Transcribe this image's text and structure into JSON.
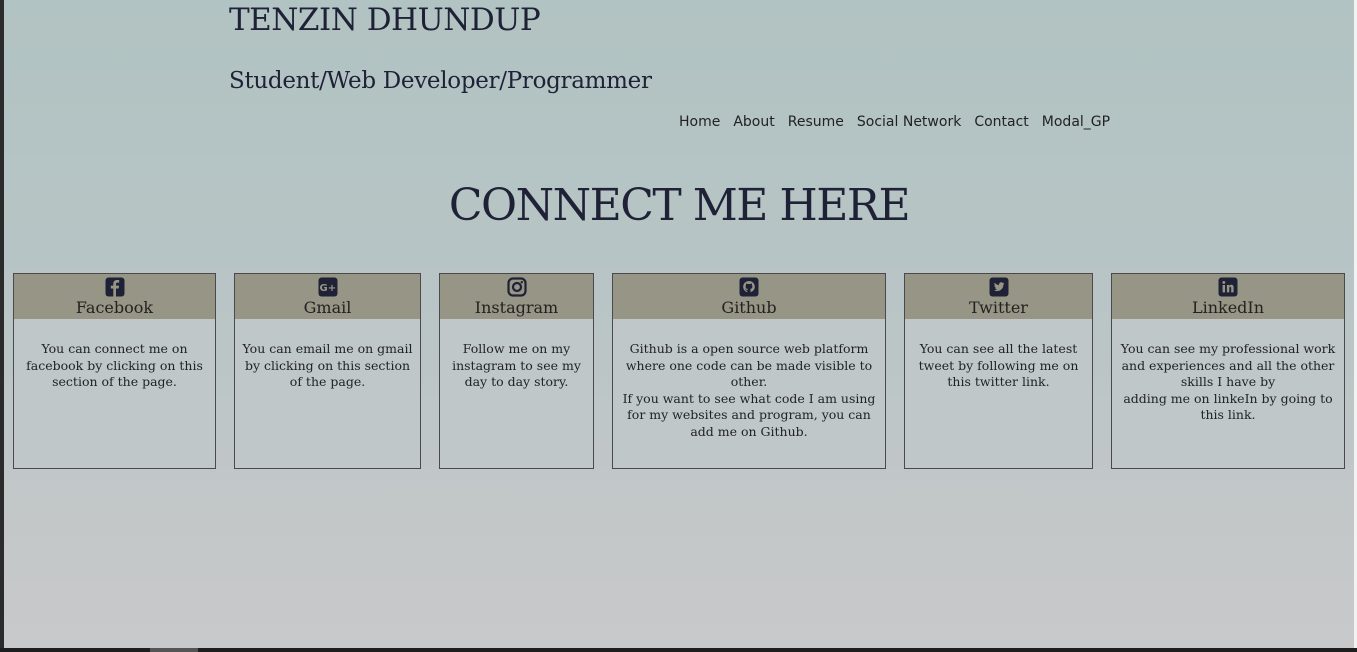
{
  "header": {
    "title": "TENZIN DHUNDUP",
    "subtitle": "Student/Web Developer/Programmer"
  },
  "nav": {
    "items": [
      "Home",
      "About",
      "Resume",
      "Social Network",
      "Contact",
      "Modal_GP"
    ]
  },
  "main": {
    "heading": "CONNECT ME HERE"
  },
  "cards": [
    {
      "title": "Facebook",
      "icon": "facebook-icon",
      "text": "You can connect me on facebook by clicking on this section of the page."
    },
    {
      "title": "Gmail",
      "icon": "google-plus-icon",
      "text": "You can email me on gmail by clicking on this section of the page."
    },
    {
      "title": "Instagram",
      "icon": "instagram-icon",
      "text": "Follow me on my instagram to see my day to day story."
    },
    {
      "title": "Github",
      "icon": "github-icon",
      "text": "Github is a open source web platform where one code can be made visible to other.\nIf you want to see what code I am using for my websites and program, you can add me on Github."
    },
    {
      "title": "Twitter",
      "icon": "twitter-icon",
      "text": "You can see all the latest tweet by following me on this twitter link."
    },
    {
      "title": "LinkedIn",
      "icon": "linkedin-icon",
      "text": "You can see my professional work and experiences and all the other skills I have by\nadding me on linkeIn by going to this link."
    }
  ],
  "colors": {
    "background": "#b4c3c3",
    "card_header": "#979585",
    "card_body": "#bfc7c9",
    "heading_text": "#1f2236"
  }
}
